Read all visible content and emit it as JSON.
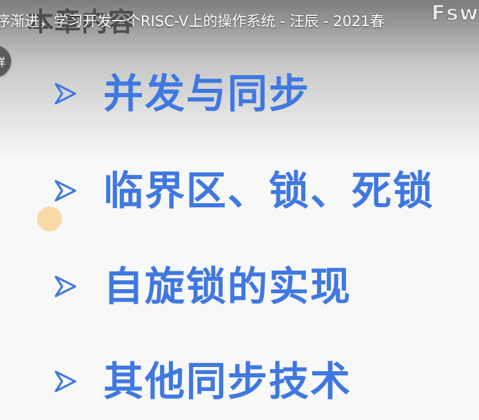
{
  "video_player": {
    "title": "序渐进，学习开发一个RISC-V上的操作系统 - 汪辰 - 2021春",
    "watermark": "Fsw",
    "avatar_label": "详"
  },
  "slide": {
    "heading": "本章内容",
    "accent_color": "#3f78e0",
    "bullet_icon": "chevron-right-outline-icon",
    "bullets": [
      {
        "label": "并发与同步"
      },
      {
        "label": "临界区、锁、死锁"
      },
      {
        "label": "自旋锁的实现"
      },
      {
        "label": "其他同步技术"
      }
    ]
  }
}
